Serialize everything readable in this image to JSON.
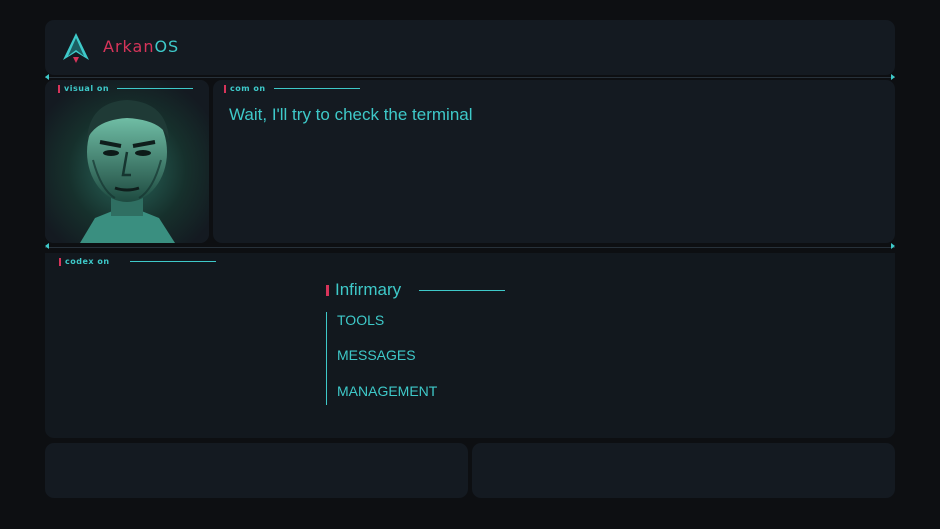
{
  "app": {
    "name_part1": "Arkan",
    "name_part2": "OS"
  },
  "sections": {
    "visual_label": "visual on",
    "com_label": "com on",
    "codex_label": "codex on"
  },
  "com": {
    "message": "Wait, I'll try to check the terminal"
  },
  "codex": {
    "title": "Infirmary",
    "items": [
      {
        "label": "TOOLS"
      },
      {
        "label": "MESSAGES"
      },
      {
        "label": "MANAGEMENT"
      }
    ]
  },
  "colors": {
    "accent": "#3ec9c9",
    "brand": "#d7345a",
    "panel": "#141a21",
    "background": "#0d0f12"
  },
  "icons": {
    "logo": "arkan-logo-icon",
    "portrait": "avatar-portrait"
  }
}
